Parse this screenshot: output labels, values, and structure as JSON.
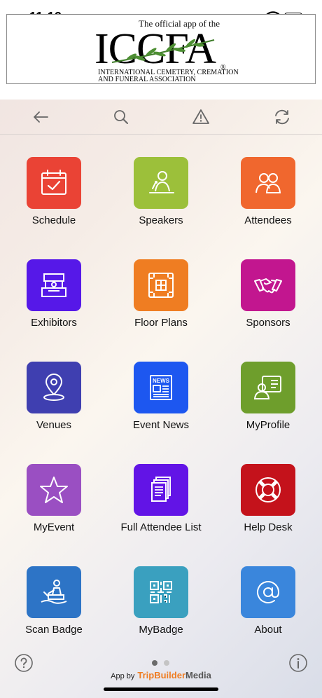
{
  "status_bar": {
    "time": "11:12"
  },
  "banner": {
    "tagline": "The official app of the",
    "logo_text": "ICCFA",
    "registered": "®",
    "org_line1": "INTERNATIONAL CEMETERY, CREMATION",
    "org_line2": "AND FUNERAL ASSOCIATION"
  },
  "toolbar": {
    "icons": [
      "back-arrow-icon",
      "search-icon",
      "alert-icon",
      "refresh-icon"
    ]
  },
  "tiles": [
    {
      "label": "Schedule",
      "color": "#ea4335",
      "icon": "calendar-check-icon"
    },
    {
      "label": "Speakers",
      "color": "#9cc03a",
      "icon": "speaker-icon"
    },
    {
      "label": "Attendees",
      "color": "#f0672e",
      "icon": "people-icon"
    },
    {
      "label": "Exhibitors",
      "color": "#5618e8",
      "icon": "booth-icon"
    },
    {
      "label": "Floor Plans",
      "color": "#ef7d22",
      "icon": "floor-plan-icon"
    },
    {
      "label": "Sponsors",
      "color": "#c2168f",
      "icon": "handshake-icon"
    },
    {
      "label": "Venues",
      "color": "#3f3fb0",
      "icon": "location-pin-icon"
    },
    {
      "label": "Event News",
      "color": "#1d57f0",
      "icon": "newspaper-icon"
    },
    {
      "label": "MyProfile",
      "color": "#6e9e2c",
      "icon": "profile-card-icon"
    },
    {
      "label": "MyEvent",
      "color": "#9a4fc2",
      "icon": "star-icon"
    },
    {
      "label": "Full Attendee List",
      "color": "#6214e6",
      "icon": "documents-icon"
    },
    {
      "label": "Help Desk",
      "color": "#c4121b",
      "icon": "lifebuoy-icon"
    },
    {
      "label": "Scan Badge",
      "color": "#2d74c6",
      "icon": "scan-person-icon"
    },
    {
      "label": "MyBadge",
      "color": "#3aa0bf",
      "icon": "qr-code-icon"
    },
    {
      "label": "About",
      "color": "#3a86dc",
      "icon": "at-sign-icon"
    }
  ],
  "footer": {
    "help_icon": "question-icon",
    "info_icon": "info-icon",
    "credit_prefix": "App by",
    "credit_brand": "TripBuilder",
    "credit_brand2": "Media",
    "page_dots": {
      "count": 2,
      "active": 0
    }
  }
}
